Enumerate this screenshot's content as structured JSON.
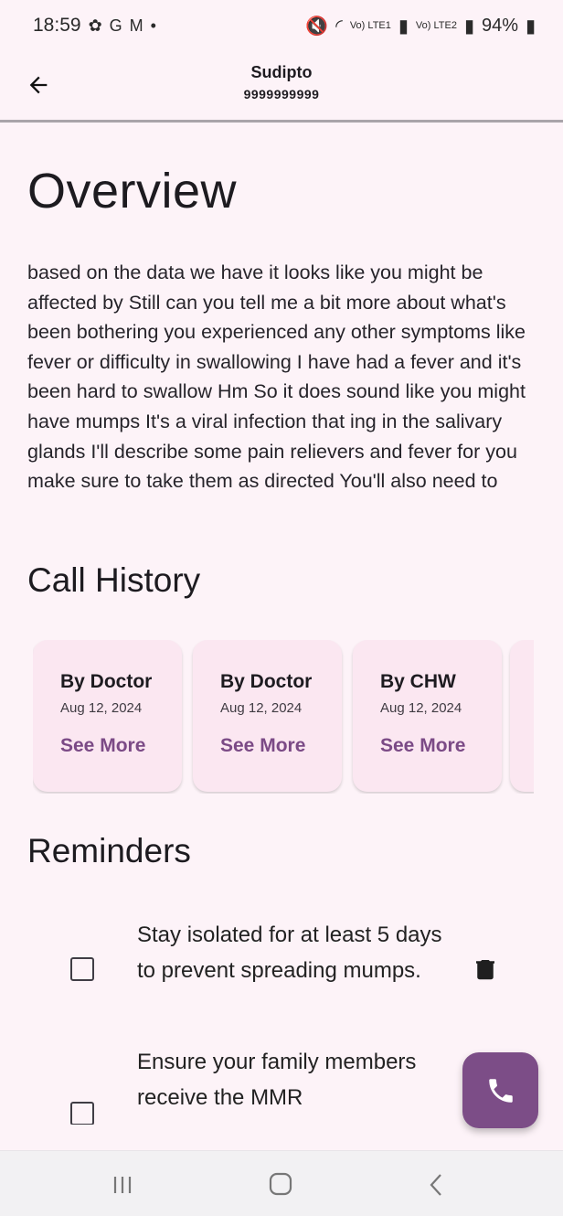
{
  "status_bar": {
    "time": "18:59",
    "left_icons": [
      "gear-like-icon",
      "g-icon",
      "gmail-icon",
      "dot-icon"
    ],
    "signal_label_1": "Vo) LTE1",
    "signal_label_2": "Vo) LTE2",
    "battery": "94%"
  },
  "header": {
    "title": "Sudipto",
    "subtitle": "9999999999"
  },
  "overview": {
    "title": "Overview",
    "text": "based on the data we have it looks like you might be affected by Still can you tell me a bit more about what's been bothering you experienced any other symptoms like fever or difficulty in swallowing I have had a fever and it's been hard to swallow Hm So it does sound like you might have mumps It's a viral infection that ing in the salivary glands I'll describe some pain relievers and fever for you make sure to take them as directed You'll also need to"
  },
  "call_history": {
    "title": "Call History",
    "cards": [
      {
        "title": "By Doctor",
        "date": "Aug 12, 2024",
        "link": "See More"
      },
      {
        "title": "By Doctor",
        "date": "Aug 12, 2024",
        "link": "See More"
      },
      {
        "title": "By CHW",
        "date": "Aug 12, 2024",
        "link": "See More"
      }
    ]
  },
  "reminders": {
    "title": "Reminders",
    "items": [
      {
        "text": "Stay isolated for at least 5 days to prevent spreading mumps."
      },
      {
        "text": "Ensure your family members receive the MMR"
      }
    ]
  },
  "colors": {
    "background": "#fdf3f8",
    "card": "#fbe7f1",
    "accent": "#7c4d87",
    "link": "#7b4a86"
  }
}
